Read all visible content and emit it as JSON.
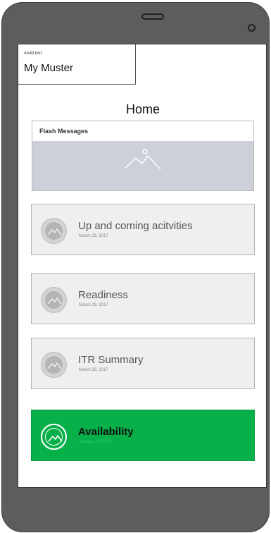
{
  "header": {
    "add_text_label": "#Add text",
    "app_title": "My Muster"
  },
  "page": {
    "title": "Home"
  },
  "flash": {
    "header": "Flash Messages"
  },
  "cards": [
    {
      "title": "Up and coming acitvities",
      "date": "March 29, 2017"
    },
    {
      "title": "Readiness",
      "date": "March 29, 2017"
    },
    {
      "title": "ITR Summary",
      "date": "March 29, 2017"
    },
    {
      "title": "Availability",
      "date": "January 29, 2021"
    }
  ],
  "colors": {
    "accent_green": "#08b04a",
    "phone_body": "#5d5d5d",
    "image_placeholder": "#cdd0d8"
  }
}
